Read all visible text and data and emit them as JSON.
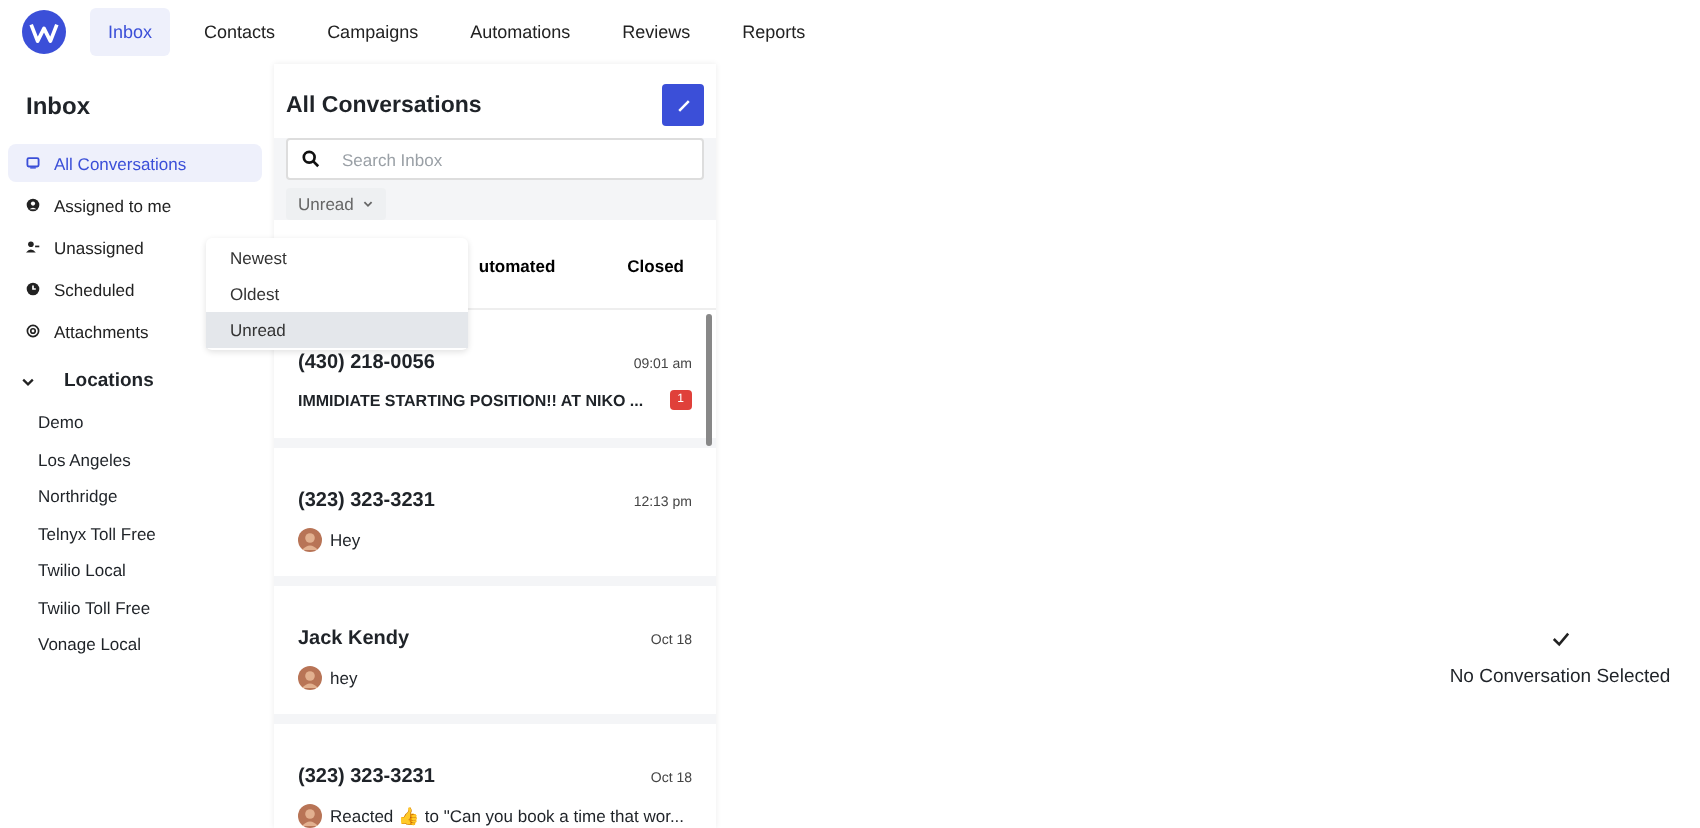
{
  "nav": {
    "items": [
      {
        "label": "Inbox",
        "selected": true
      },
      {
        "label": "Contacts",
        "selected": false
      },
      {
        "label": "Campaigns",
        "selected": false
      },
      {
        "label": "Automations",
        "selected": false
      },
      {
        "label": "Reviews",
        "selected": false
      },
      {
        "label": "Reports",
        "selected": false
      }
    ]
  },
  "sidebar": {
    "title": "Inbox",
    "items": [
      {
        "label": "All Conversations",
        "selected": true
      },
      {
        "label": "Assigned to me",
        "selected": false
      },
      {
        "label": "Unassigned",
        "selected": false
      },
      {
        "label": "Scheduled",
        "selected": false
      },
      {
        "label": "Attachments",
        "selected": false
      }
    ],
    "locations": {
      "title": "Locations",
      "expanded": true,
      "items": [
        "Demo",
        "Los Angeles",
        "Northridge",
        "Telnyx Toll Free",
        "Twilio Local",
        "Twilio Toll Free",
        "Vonage Local"
      ]
    }
  },
  "conversations": {
    "title": "All Conversations",
    "search": {
      "placeholder": "Search Inbox"
    },
    "sort": "Unread",
    "sort_menu": [
      {
        "label": "Newest",
        "selected": false
      },
      {
        "label": "Oldest",
        "selected": false
      },
      {
        "label": "Unread",
        "selected": true
      }
    ],
    "tabs": [
      {
        "label": "utomated"
      },
      {
        "label": "Closed"
      }
    ],
    "items": [
      {
        "name": "(430) 218-0056",
        "time": "09:01 am",
        "preview": "IMMIDIATE STARTING POSITION!! AT NIKO ...",
        "bold": true,
        "avatar": false,
        "badge": "1"
      },
      {
        "name": "(323) 323-3231",
        "time": "12:13 pm",
        "preview": "Hey",
        "bold": false,
        "avatar": true
      },
      {
        "name": "Jack Kendy",
        "time": "Oct 18",
        "preview": "hey",
        "bold": false,
        "avatar": true
      },
      {
        "name": "(323) 323-3231",
        "time": "Oct 18",
        "preview": "Reacted 👍 to \"Can you book a time that wor...",
        "bold": false,
        "avatar": true
      }
    ]
  },
  "detail": {
    "empty_text": "No Conversation Selected"
  }
}
